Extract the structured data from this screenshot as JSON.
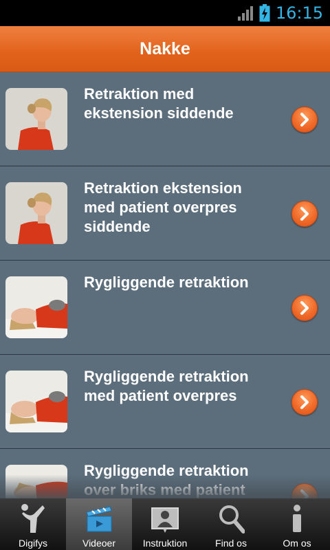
{
  "status_bar": {
    "time": "16:15"
  },
  "header": {
    "title": "Nakke"
  },
  "exercises": [
    {
      "title": "Retraktion med ekstension siddende",
      "thumbnail": "seated-profile"
    },
    {
      "title": "Retraktion ekstension med patient overpres siddende",
      "thumbnail": "seated-profile"
    },
    {
      "title": "Rygliggende retraktion",
      "thumbnail": "lying-supine"
    },
    {
      "title": "Rygliggende retraktion med patient overpres",
      "thumbnail": "lying-supine"
    },
    {
      "title": "Rygliggende retraktion over briks med patient",
      "thumbnail": "lying-supine"
    }
  ],
  "tabs": [
    {
      "label": "Digifys",
      "icon": "person-logo-icon",
      "active": false
    },
    {
      "label": "Videoer",
      "icon": "video-clapper-icon",
      "active": true
    },
    {
      "label": "Instruktion",
      "icon": "instructor-icon",
      "active": false
    },
    {
      "label": "Find os",
      "icon": "magnifier-icon",
      "active": false
    },
    {
      "label": "Om os",
      "icon": "info-icon",
      "active": false
    }
  ],
  "colors": {
    "accent": "#e2641c",
    "list_bg": "#5c6e7c",
    "status_clock": "#33b5e5"
  }
}
